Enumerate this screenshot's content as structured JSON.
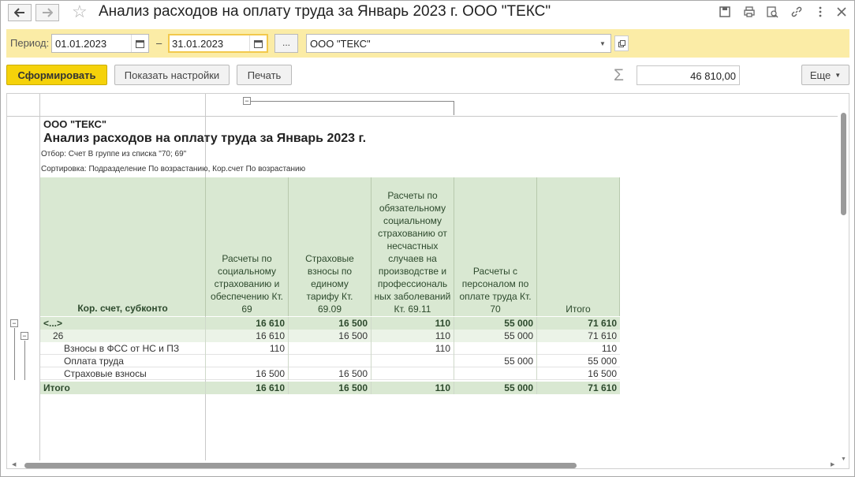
{
  "window": {
    "title": "Анализ расходов на оплату труда за Январь 2023 г. ООО \"ТЕКС\""
  },
  "params": {
    "period_label": "Период:",
    "date_from": "01.01.2023",
    "date_separator": "–",
    "date_to": "31.01.2023",
    "dots_label": "...",
    "organization": "ООО \"ТЕКС\""
  },
  "toolbar": {
    "generate_label": "Сформировать",
    "settings_label": "Показать настройки",
    "print_label": "Печать",
    "sum_value": "46 810,00",
    "more_label": "Еще"
  },
  "report": {
    "org": "ООО \"ТЕКС\"",
    "title": "Анализ расходов на оплату труда за Январь 2023 г.",
    "filter": "Отбор: Счет В группе из списка \"70; 69\"",
    "sorting": "Сортировка: Подразделение По возрастанию, Кор.счет По возрастанию",
    "columns": [
      "Кор. счет, субконто",
      "Расчеты по социальному страхованию и обеспечению Кт. 69",
      "Страховые взносы по единому тарифу Кт. 69.09",
      "Расчеты по обязательному социальному страхованию от несчастных случаев на производстве и профессиональ ных заболеваний Кт. 69.11",
      "Расчеты с персоналом по оплате труда Кт. 70",
      "Итого"
    ],
    "rows": [
      {
        "label": "<...>",
        "c1": "16 610",
        "c2": "16 500",
        "c3": "110",
        "c4": "55 000",
        "c5": "71 610"
      },
      {
        "label": "26",
        "c1": "16 610",
        "c2": "16 500",
        "c3": "110",
        "c4": "55 000",
        "c5": "71 610"
      },
      {
        "label": "Взносы в ФСС от НС и ПЗ",
        "c1": "110",
        "c2": "",
        "c3": "110",
        "c4": "",
        "c5": "110"
      },
      {
        "label": "Оплата труда",
        "c1": "",
        "c2": "",
        "c3": "",
        "c4": "55 000",
        "c5": "55 000"
      },
      {
        "label": "Страховые взносы",
        "c1": "16 500",
        "c2": "16 500",
        "c3": "",
        "c4": "",
        "c5": "16 500"
      },
      {
        "label": "Итого",
        "c1": "16 610",
        "c2": "16 500",
        "c3": "110",
        "c4": "55 000",
        "c5": "71 610"
      }
    ]
  },
  "colors": {
    "accent_yellow": "#f5d20a",
    "param_bar": "#fbeca6",
    "table_header": "#d9e8d2"
  }
}
